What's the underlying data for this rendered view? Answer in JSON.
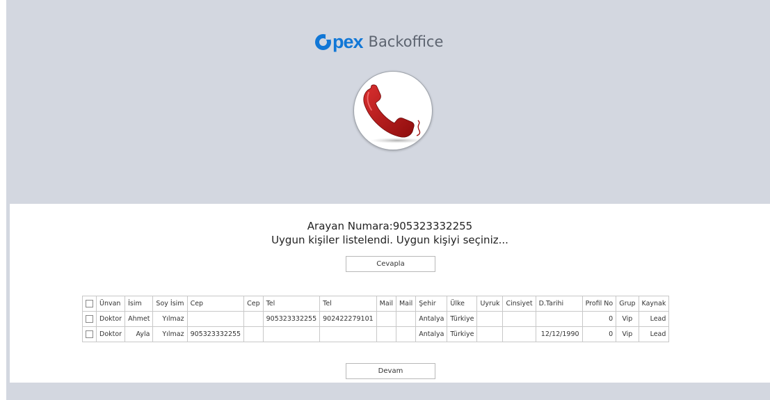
{
  "brand": {
    "logo_word": "pex",
    "logo_sub": "Backoffice",
    "color": "#1177d6"
  },
  "caller": {
    "line1": "Arayan Numara:905323332255",
    "line2": "Uygun kişiler listelendi. Uygun kişiyi seçiniz..."
  },
  "buttons": {
    "answer": "Cevapla",
    "continue": "Devam"
  },
  "table": {
    "headers": [
      "Ünvan",
      "İsim",
      "Soy İsim",
      "Cep",
      "Cep",
      "Tel",
      "Tel",
      "Mail",
      "Mail",
      "Şehir",
      "Ülke",
      "Uyruk",
      "Cinsiyet",
      "D.Tarihi",
      "Profil No",
      "Grup",
      "Kaynak"
    ],
    "rows": [
      [
        "Doktor",
        "Ahmet",
        "Yılmaz",
        "",
        "",
        "905323332255",
        "902422279101",
        "",
        "",
        "Antalya",
        "Türkiye",
        "",
        "",
        "",
        "0",
        "Vip",
        "Lead"
      ],
      [
        "Doktor",
        "Ayla",
        "Yılmaz",
        "905323332255",
        "",
        "",
        "",
        "",
        "",
        "Antalya",
        "Türkiye",
        "",
        "",
        "12/12/1990",
        "0",
        "Vip",
        "Lead"
      ]
    ]
  },
  "icons": {
    "phone": "phone-handset-icon",
    "checkbox": "checkbox-icon"
  }
}
